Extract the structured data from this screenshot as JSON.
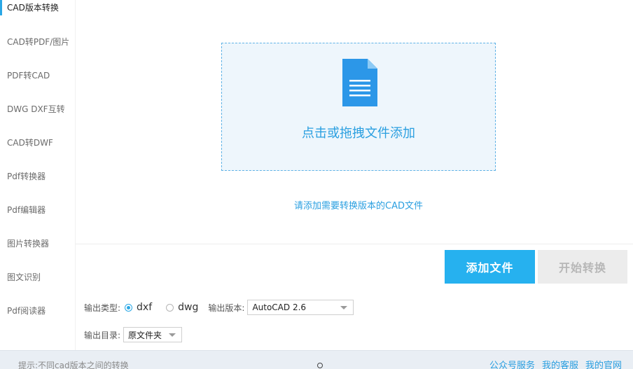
{
  "sidebar": {
    "items": [
      {
        "label": "CAD版本转换"
      },
      {
        "label": "CAD转PDF/图片"
      },
      {
        "label": "PDF转CAD"
      },
      {
        "label": "DWG DXF互转"
      },
      {
        "label": "CAD转DWF"
      },
      {
        "label": "Pdf转换器"
      },
      {
        "label": "Pdf编辑器"
      },
      {
        "label": "图片转换器"
      },
      {
        "label": "图文识别"
      },
      {
        "label": "Pdf阅读器"
      }
    ]
  },
  "dropzone": {
    "icon": "document-icon",
    "text": "点击或拖拽文件添加"
  },
  "hint_link": "请添加需要转换版本的CAD文件",
  "actions": {
    "add": "添加文件",
    "start": "开始转换"
  },
  "options": {
    "type_label": "输出类型:",
    "types": [
      {
        "label": "dxf",
        "checked": true
      },
      {
        "label": "dwg",
        "checked": false
      }
    ],
    "version_label": "输出版本:",
    "version_value": "AutoCAD 2.6",
    "dir_label": "输出目录:",
    "dir_value": "原文件夹"
  },
  "footer": {
    "tip": "提示:不同cad版本之间的转换",
    "links": [
      "公众号服务",
      "我的客服",
      "我的官网"
    ]
  },
  "colors": {
    "accent": "#26b1ef",
    "link": "#2a9fe0",
    "disabled_bg": "#ececec"
  }
}
